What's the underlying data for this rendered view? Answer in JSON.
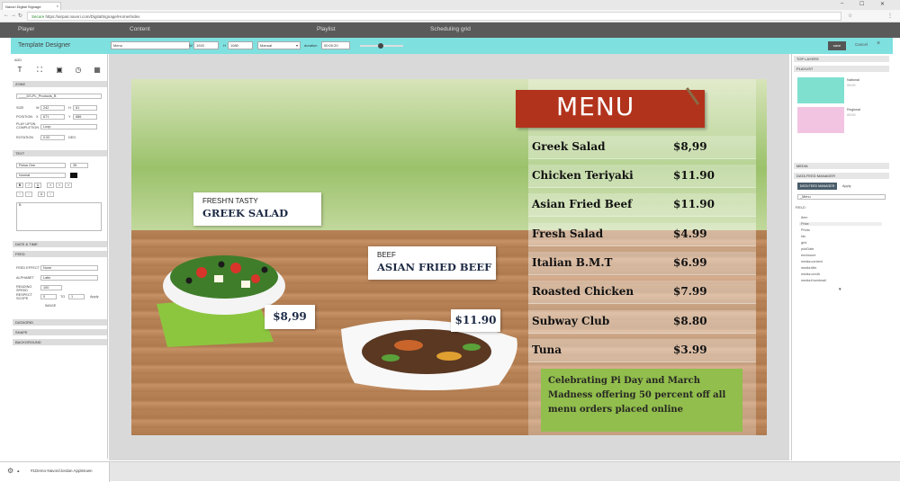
{
  "browser": {
    "tab_title": "Navori Digital Signage",
    "secure_label": "Secure",
    "url": "https://airpair.navori.com/DigitalSignage/Home/Index"
  },
  "appbar": {
    "tabs": [
      "Player",
      "Content",
      "Playlist",
      "Scheduling grid"
    ]
  },
  "designer": {
    "title": "Template Designer",
    "name_value": "Menu",
    "width_label": "W",
    "width_value": "1920",
    "height_label": "H",
    "height_value": "1080",
    "mode_value": "Manual",
    "duration_label": "duration",
    "duration_value": "00:00:20",
    "save_label": "save",
    "cancel_label": "Cancel"
  },
  "left": {
    "add_label": "ADD",
    "zone_label": "ZONE",
    "zone_name": "____DS-PL_Products_B",
    "size_label": "SIZE",
    "size_w": "242",
    "size_h": "61",
    "position_label": "POSITION",
    "pos_x": "671",
    "pos_y": "686",
    "play_upon_label": "PLAY UPON COMPLETION",
    "play_upon_value": "Loop",
    "rotation_label": "ROTATION",
    "rotation_value": "0.00",
    "deg_label": "DEG",
    "text_label": "TEXT",
    "font_value": "Patua One",
    "font_size": "35",
    "font_style": "Normal",
    "text_content": "B",
    "datetime_label": "DATE & TIME",
    "feed_label": "FEED",
    "feed_effect_label": "FEED EFFECT",
    "feed_effect_value": "None",
    "alphabet_label": "ALPHABET",
    "alphabet_value": "Latin",
    "reading_speed_label": "READING SPEED",
    "reading_speed_value": "100",
    "respect_label": "RESPECT SCOPE",
    "respect_value": "0",
    "to_label": "TO",
    "to_value": "1",
    "apply_label": "Apply",
    "image_label": "IMAGE",
    "datagrid_label": "DATAGRID",
    "shape_label": "SHAPE",
    "background_label": "BACKGROUND"
  },
  "menu": {
    "title": "MENU",
    "items": [
      {
        "name": "Greek Salad",
        "price": "$8,99"
      },
      {
        "name": "Chicken Teriyaki",
        "price": "$11.90"
      },
      {
        "name": "Asian Fried Beef",
        "price": "$11.90"
      },
      {
        "name": "Fresh Salad",
        "price": "$4.99"
      },
      {
        "name": "Italian B.M.T",
        "price": "$6.99"
      },
      {
        "name": "Roasted Chicken",
        "price": "$7.99"
      },
      {
        "name": "Subway Club",
        "price": "$8.80"
      },
      {
        "name": "Tuna",
        "price": "$3.99"
      }
    ],
    "promo": "Celebrating Pi Day and March Madness offering 50 percent off all menu orders placed online",
    "card1_small": "FRESH'N TASTY",
    "card1_large": "GREEK SALAD",
    "card1_price": "$8,99",
    "card2_small": "BEEF",
    "card2_large": "ASIAN FRIED BEEF",
    "card2_price": "$11.90"
  },
  "right": {
    "top_layers": "TOP LAYERS",
    "playlist_label": "PLAYLIST",
    "pl1_name": "National",
    "pl1_meta": "00:00",
    "pl2_name": "Regional",
    "pl2_meta": "00:00",
    "media_label": "MEDIA",
    "data_feed_label": "DATA FEED MANAGER",
    "data_feed_btn": "DATA FEED MANAGER",
    "apply_label": "Apply",
    "feed_select": "_Menu",
    "field_label": "FIELD",
    "fields": [
      "Item",
      "Price",
      "Photo",
      "Ids",
      "grid",
      "pubDate",
      "enclosure",
      "media:content",
      "media:title",
      "media:credit",
      "media:thumbnail"
    ]
  },
  "status": {
    "text": "#1Demo-Navori/Jordan Appletown"
  },
  "colors": {
    "accent": "#7fe0e0",
    "banner": "#b2331c",
    "promo": "#8fc04a"
  }
}
